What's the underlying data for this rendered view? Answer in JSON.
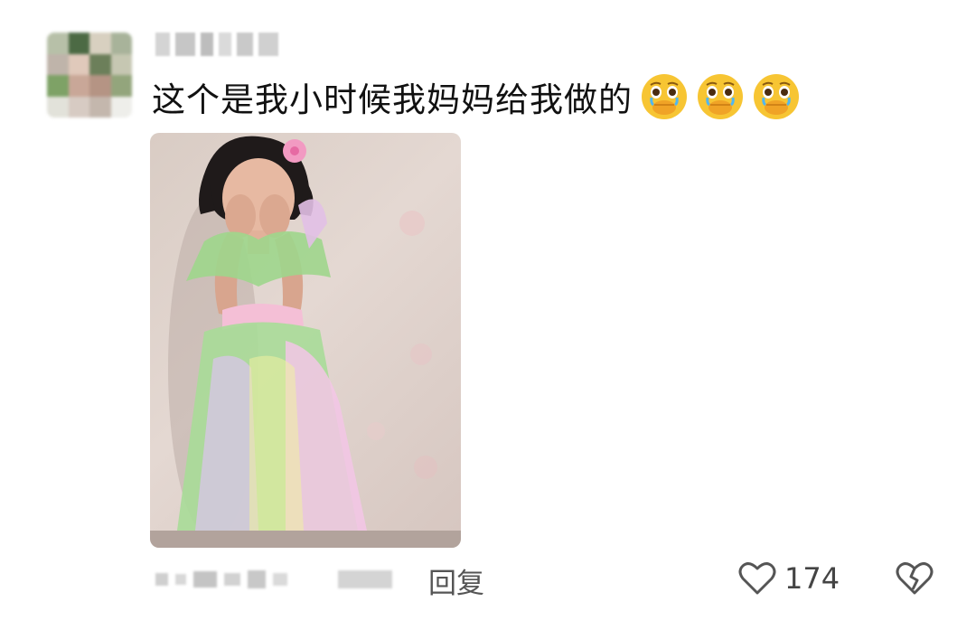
{
  "comment": {
    "text": "这个是我小时候我妈妈给我做的",
    "emoji_icons": [
      "crying-face-covering-mouth-icon",
      "crying-face-covering-mouth-icon",
      "crying-face-covering-mouth-icon"
    ],
    "reply_label": "回复",
    "like_count": "174"
  },
  "colors": {
    "text": "#111111",
    "secondary_text": "#555555",
    "emoji_face": "#f7c533",
    "tear": "#4fb6f2"
  }
}
